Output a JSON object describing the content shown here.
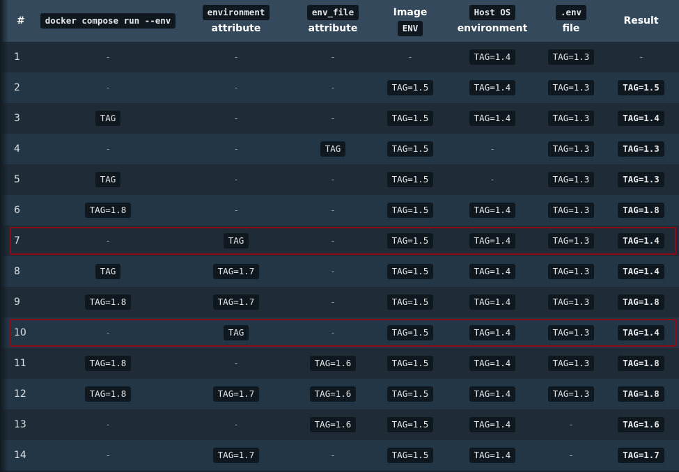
{
  "table": {
    "headers": [
      {
        "name": "num",
        "lines": [
          {
            "text": "#",
            "code": false
          }
        ]
      },
      {
        "name": "cli-env",
        "lines": [
          {
            "text": "docker compose run --env",
            "code": true
          }
        ]
      },
      {
        "name": "environment-attribute",
        "lines": [
          {
            "text": "environment",
            "code": true
          },
          {
            "text": "attribute",
            "code": false
          }
        ]
      },
      {
        "name": "env-file-attribute",
        "lines": [
          {
            "text": "env_file",
            "code": true
          },
          {
            "text": "attribute",
            "code": false
          }
        ]
      },
      {
        "name": "image-env",
        "lines": [
          {
            "text": "Image",
            "code": false
          },
          {
            "text": "ENV",
            "code": true
          }
        ]
      },
      {
        "name": "host-os-environment",
        "lines": [
          {
            "text": "Host OS",
            "code": true
          },
          {
            "text": "environment",
            "code": false
          }
        ]
      },
      {
        "name": "dotenv-file",
        "lines": [
          {
            "text": ".env",
            "code": true
          },
          {
            "text": "file",
            "code": false
          }
        ]
      },
      {
        "name": "result",
        "lines": [
          {
            "text": "Result",
            "code": false
          }
        ]
      }
    ],
    "rows": [
      [
        "1",
        "-",
        "-",
        "-",
        "-",
        "TAG=1.4",
        "TAG=1.3",
        "-"
      ],
      [
        "2",
        "-",
        "-",
        "-",
        "TAG=1.5",
        "TAG=1.4",
        "TAG=1.3",
        "TAG=1.5"
      ],
      [
        "3",
        "TAG",
        "-",
        "-",
        "TAG=1.5",
        "TAG=1.4",
        "TAG=1.3",
        "TAG=1.4"
      ],
      [
        "4",
        "-",
        "-",
        "TAG",
        "TAG=1.5",
        "-",
        "TAG=1.3",
        "TAG=1.3"
      ],
      [
        "5",
        "TAG",
        "-",
        "-",
        "TAG=1.5",
        "-",
        "TAG=1.3",
        "TAG=1.3"
      ],
      [
        "6",
        "TAG=1.8",
        "-",
        "-",
        "TAG=1.5",
        "TAG=1.4",
        "TAG=1.3",
        "TAG=1.8"
      ],
      [
        "7",
        "-",
        "TAG",
        "-",
        "TAG=1.5",
        "TAG=1.4",
        "TAG=1.3",
        "TAG=1.4"
      ],
      [
        "8",
        "TAG",
        "TAG=1.7",
        "-",
        "TAG=1.5",
        "TAG=1.4",
        "TAG=1.3",
        "TAG=1.4"
      ],
      [
        "9",
        "TAG=1.8",
        "TAG=1.7",
        "-",
        "TAG=1.5",
        "TAG=1.4",
        "TAG=1.3",
        "TAG=1.8"
      ],
      [
        "10",
        "-",
        "TAG",
        "-",
        "TAG=1.5",
        "TAG=1.4",
        "TAG=1.3",
        "TAG=1.4"
      ],
      [
        "11",
        "TAG=1.8",
        "-",
        "TAG=1.6",
        "TAG=1.5",
        "TAG=1.4",
        "TAG=1.3",
        "TAG=1.8"
      ],
      [
        "12",
        "TAG=1.8",
        "TAG=1.7",
        "TAG=1.6",
        "TAG=1.5",
        "TAG=1.4",
        "TAG=1.3",
        "TAG=1.8"
      ],
      [
        "13",
        "-",
        "-",
        "TAG=1.6",
        "TAG=1.5",
        "TAG=1.4",
        "-",
        "TAG=1.6"
      ],
      [
        "14",
        "-",
        "TAG=1.7",
        "-",
        "TAG=1.5",
        "TAG=1.4",
        "-",
        "TAG=1.7"
      ]
    ],
    "highlighted_rows": [
      "7",
      "10"
    ]
  },
  "colors": {
    "header_bg": "#34495b",
    "row_odd_bg": "#1f2c37",
    "row_even_bg": "#233645",
    "code_bg": "#10181f",
    "highlight_border": "#8b0c14"
  }
}
